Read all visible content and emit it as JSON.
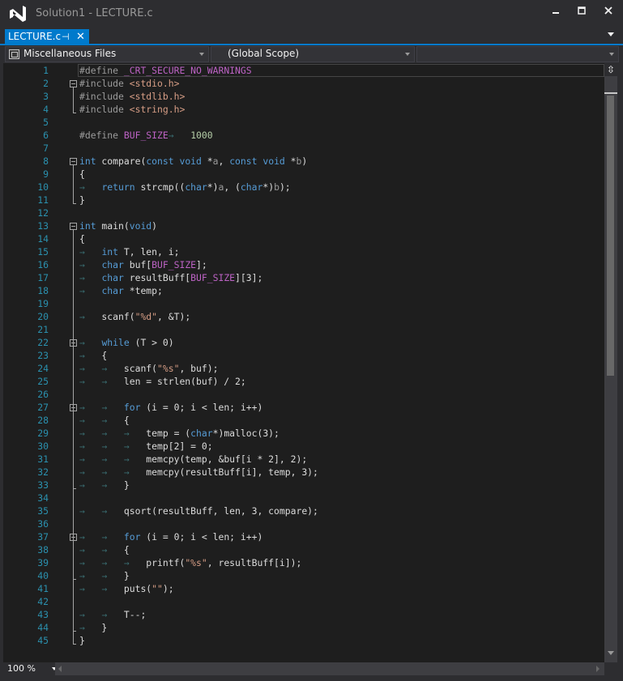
{
  "window": {
    "title": "Solution1 - LECTURE.c",
    "minimize_glyph": "▬",
    "maximize_glyph": "□",
    "close_glyph": "✕",
    "accent_color": "#007acc"
  },
  "tab": {
    "label": "LECTURE.c",
    "pin_icon": "pin-icon",
    "close_icon": "close-icon"
  },
  "navbar": {
    "project": "Miscellaneous Files",
    "scope": "(Global Scope)",
    "member": ""
  },
  "editor": {
    "lines": [
      {
        "n": "1",
        "tokens": [
          [
            "pp",
            "#define"
          ],
          [
            "",
            " "
          ],
          [
            "mac",
            "_CRT_SECURE_NO_WARNINGS"
          ]
        ]
      },
      {
        "n": "2",
        "fold": true,
        "tokens": [
          [
            "pp",
            "#include"
          ],
          [
            "",
            ""
          ],
          [
            "str",
            " <stdio.h>"
          ]
        ]
      },
      {
        "n": "3",
        "tokens": [
          [
            "pp",
            "#include"
          ],
          [
            "str",
            " <stdlib.h>"
          ]
        ]
      },
      {
        "n": "4",
        "tokens": [
          [
            "pp",
            "#include"
          ],
          [
            "str",
            " <string.h>"
          ]
        ]
      },
      {
        "n": "5",
        "tokens": []
      },
      {
        "n": "6",
        "tokens": [
          [
            "pp",
            "#define"
          ],
          [
            "",
            " "
          ],
          [
            "mac",
            "BUF_SIZE"
          ],
          [
            "tabg",
            "→"
          ],
          [
            "",
            "   "
          ],
          [
            "num",
            "1000"
          ]
        ]
      },
      {
        "n": "7",
        "tokens": []
      },
      {
        "n": "8",
        "fold": true,
        "tokens": [
          [
            "kw",
            "int"
          ],
          [
            "",
            " compare("
          ],
          [
            "kw",
            "const"
          ],
          [
            "",
            " "
          ],
          [
            "kw",
            "void"
          ],
          [
            "",
            " *"
          ],
          [
            "prm",
            "a"
          ],
          [
            "",
            ", "
          ],
          [
            "kw",
            "const"
          ],
          [
            "",
            " "
          ],
          [
            "kw",
            "void"
          ],
          [
            "",
            " *"
          ],
          [
            "prm",
            "b"
          ],
          [
            "",
            ")"
          ]
        ]
      },
      {
        "n": "9",
        "tokens": [
          [
            "",
            "{"
          ]
        ]
      },
      {
        "n": "10",
        "tokens": [
          [
            "tabg",
            "→"
          ],
          [
            "",
            "   "
          ],
          [
            "kw",
            "return"
          ],
          [
            "",
            " strcmp(("
          ],
          [
            "kw",
            "char"
          ],
          [
            "",
            "*)"
          ],
          [
            "prm",
            "a"
          ],
          [
            "",
            ", ("
          ],
          [
            "kw",
            "char"
          ],
          [
            "",
            "*)"
          ],
          [
            "prm",
            "b"
          ],
          [
            "",
            ");"
          ]
        ]
      },
      {
        "n": "11",
        "tokens": [
          [
            "",
            "}"
          ]
        ]
      },
      {
        "n": "12",
        "tokens": []
      },
      {
        "n": "13",
        "fold": true,
        "tokens": [
          [
            "kw",
            "int"
          ],
          [
            "",
            " main("
          ],
          [
            "kw",
            "void"
          ],
          [
            "",
            ")"
          ]
        ]
      },
      {
        "n": "14",
        "tokens": [
          [
            "",
            "{"
          ]
        ]
      },
      {
        "n": "15",
        "tokens": [
          [
            "tabg",
            "→"
          ],
          [
            "",
            "   "
          ],
          [
            "kw",
            "int"
          ],
          [
            "",
            " T, len, i;"
          ]
        ]
      },
      {
        "n": "16",
        "tokens": [
          [
            "tabg",
            "→"
          ],
          [
            "",
            "   "
          ],
          [
            "kw",
            "char"
          ],
          [
            "",
            " buf["
          ],
          [
            "mac",
            "BUF_SIZE"
          ],
          [
            "",
            "];"
          ]
        ]
      },
      {
        "n": "17",
        "tokens": [
          [
            "tabg",
            "→"
          ],
          [
            "",
            "   "
          ],
          [
            "kw",
            "char"
          ],
          [
            "",
            " resultBuff["
          ],
          [
            "mac",
            "BUF_SIZE"
          ],
          [
            "",
            "][3];"
          ]
        ]
      },
      {
        "n": "18",
        "tokens": [
          [
            "tabg",
            "→"
          ],
          [
            "",
            "   "
          ],
          [
            "kw",
            "char"
          ],
          [
            "",
            " *temp;"
          ]
        ]
      },
      {
        "n": "19",
        "tokens": []
      },
      {
        "n": "20",
        "tokens": [
          [
            "tabg",
            "→"
          ],
          [
            "",
            "   scanf("
          ],
          [
            "str",
            "\"%d\""
          ],
          [
            "",
            ", &T);"
          ]
        ]
      },
      {
        "n": "21",
        "tokens": []
      },
      {
        "n": "22",
        "fold": true,
        "tokens": [
          [
            "tabg",
            "→"
          ],
          [
            "",
            "   "
          ],
          [
            "kw",
            "while"
          ],
          [
            "",
            " (T > 0)"
          ]
        ]
      },
      {
        "n": "23",
        "tokens": [
          [
            "tabg",
            "→"
          ],
          [
            "",
            "   {"
          ]
        ]
      },
      {
        "n": "24",
        "tokens": [
          [
            "tabg",
            "→"
          ],
          [
            "",
            "   "
          ],
          [
            "tabg",
            "→"
          ],
          [
            "",
            "   scanf("
          ],
          [
            "str",
            "\"%s\""
          ],
          [
            "",
            ", buf);"
          ]
        ]
      },
      {
        "n": "25",
        "tokens": [
          [
            "tabg",
            "→"
          ],
          [
            "",
            "   "
          ],
          [
            "tabg",
            "→"
          ],
          [
            "",
            "   len = strlen(buf) / 2;"
          ]
        ]
      },
      {
        "n": "26",
        "tokens": []
      },
      {
        "n": "27",
        "fold": true,
        "tokens": [
          [
            "tabg",
            "→"
          ],
          [
            "",
            "   "
          ],
          [
            "tabg",
            "→"
          ],
          [
            "",
            "   "
          ],
          [
            "kw",
            "for"
          ],
          [
            "",
            " (i = 0; i < len; i++)"
          ]
        ]
      },
      {
        "n": "28",
        "tokens": [
          [
            "tabg",
            "→"
          ],
          [
            "",
            "   "
          ],
          [
            "tabg",
            "→"
          ],
          [
            "",
            "   {"
          ]
        ]
      },
      {
        "n": "29",
        "tokens": [
          [
            "tabg",
            "→"
          ],
          [
            "",
            "   "
          ],
          [
            "tabg",
            "→"
          ],
          [
            "",
            "   "
          ],
          [
            "tabg",
            "→"
          ],
          [
            "",
            "   temp = ("
          ],
          [
            "kw",
            "char"
          ],
          [
            "",
            "*)malloc(3);"
          ]
        ]
      },
      {
        "n": "30",
        "tokens": [
          [
            "tabg",
            "→"
          ],
          [
            "",
            "   "
          ],
          [
            "tabg",
            "→"
          ],
          [
            "",
            "   "
          ],
          [
            "tabg",
            "→"
          ],
          [
            "",
            "   temp[2] = 0;"
          ]
        ]
      },
      {
        "n": "31",
        "tokens": [
          [
            "tabg",
            "→"
          ],
          [
            "",
            "   "
          ],
          [
            "tabg",
            "→"
          ],
          [
            "",
            "   "
          ],
          [
            "tabg",
            "→"
          ],
          [
            "",
            "   memcpy(temp, &buf[i * 2], 2);"
          ]
        ]
      },
      {
        "n": "32",
        "tokens": [
          [
            "tabg",
            "→"
          ],
          [
            "",
            "   "
          ],
          [
            "tabg",
            "→"
          ],
          [
            "",
            "   "
          ],
          [
            "tabg",
            "→"
          ],
          [
            "",
            "   memcpy(resultBuff[i], temp, 3);"
          ]
        ]
      },
      {
        "n": "33",
        "tokens": [
          [
            "tabg",
            "→"
          ],
          [
            "",
            "   "
          ],
          [
            "tabg",
            "→"
          ],
          [
            "",
            "   }"
          ]
        ]
      },
      {
        "n": "34",
        "tokens": []
      },
      {
        "n": "35",
        "tokens": [
          [
            "tabg",
            "→"
          ],
          [
            "",
            "   "
          ],
          [
            "tabg",
            "→"
          ],
          [
            "",
            "   qsort(resultBuff, len, 3, compare);"
          ]
        ]
      },
      {
        "n": "36",
        "tokens": []
      },
      {
        "n": "37",
        "fold": true,
        "tokens": [
          [
            "tabg",
            "→"
          ],
          [
            "",
            "   "
          ],
          [
            "tabg",
            "→"
          ],
          [
            "",
            "   "
          ],
          [
            "kw",
            "for"
          ],
          [
            "",
            " (i = 0; i < len; i++)"
          ]
        ]
      },
      {
        "n": "38",
        "tokens": [
          [
            "tabg",
            "→"
          ],
          [
            "",
            "   "
          ],
          [
            "tabg",
            "→"
          ],
          [
            "",
            "   {"
          ]
        ]
      },
      {
        "n": "39",
        "tokens": [
          [
            "tabg",
            "→"
          ],
          [
            "",
            "   "
          ],
          [
            "tabg",
            "→"
          ],
          [
            "",
            "   "
          ],
          [
            "tabg",
            "→"
          ],
          [
            "",
            "   printf("
          ],
          [
            "str",
            "\"%s\""
          ],
          [
            "",
            ", resultBuff[i]);"
          ]
        ]
      },
      {
        "n": "40",
        "tokens": [
          [
            "tabg",
            "→"
          ],
          [
            "",
            "   "
          ],
          [
            "tabg",
            "→"
          ],
          [
            "",
            "   }"
          ]
        ]
      },
      {
        "n": "41",
        "tokens": [
          [
            "tabg",
            "→"
          ],
          [
            "",
            "   "
          ],
          [
            "tabg",
            "→"
          ],
          [
            "",
            "   puts("
          ],
          [
            "str",
            "\"\""
          ],
          [
            "",
            ");"
          ]
        ]
      },
      {
        "n": "42",
        "tokens": []
      },
      {
        "n": "43",
        "tokens": [
          [
            "tabg",
            "→"
          ],
          [
            "",
            "   "
          ],
          [
            "tabg",
            "→"
          ],
          [
            "",
            "   T--;"
          ]
        ]
      },
      {
        "n": "44",
        "tokens": [
          [
            "tabg",
            "→"
          ],
          [
            "",
            "   }"
          ]
        ]
      },
      {
        "n": "45",
        "tokens": [
          [
            "",
            "}"
          ]
        ]
      }
    ]
  },
  "bottom": {
    "zoom": "100 %"
  }
}
